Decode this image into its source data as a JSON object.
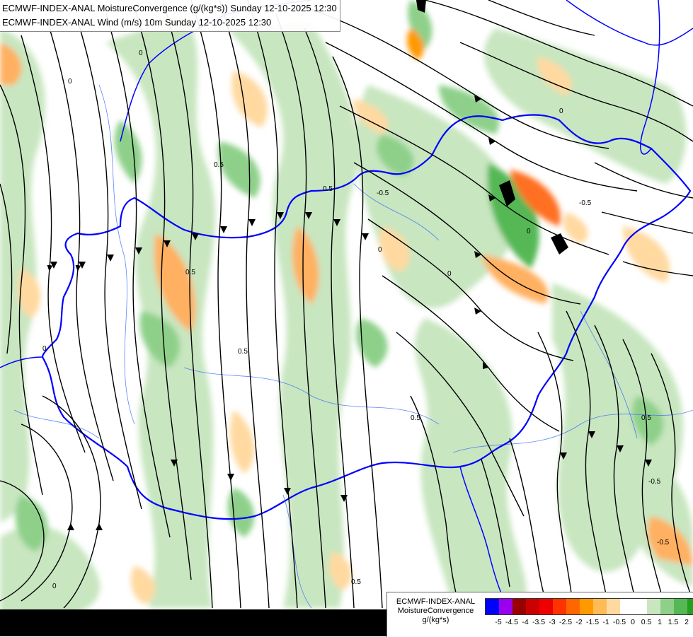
{
  "header": {
    "line1": "ECMWF-INDEX-ANAL MoistureConvergence (g/(kg*s)) Sunday 12-10-2025 12:30",
    "line2": "ECMWF-INDEX-ANAL Wind (m/s) 10m Sunday 12-10-2025 12:30"
  },
  "legend": {
    "line1": "ECMWF-INDEX-ANAL",
    "line2": "MoistureConvergence",
    "line3": "g/(kg*s)",
    "colors": [
      "#0000ff",
      "#9900ee",
      "#990000",
      "#cc0000",
      "#ee0000",
      "#ff3300",
      "#ff6600",
      "#ff9900",
      "#ffbb55",
      "#ffd9a0",
      "#ffffff",
      "#ffffff",
      "#c8e6c0",
      "#8ed08a",
      "#55b855",
      "#22a022",
      "#009900"
    ],
    "ticks": [
      "-5",
      "-4.5",
      "-4",
      "-3.5",
      "-3",
      "-2.5",
      "-2",
      "-1.5",
      "-1",
      "-0.5",
      "0",
      "0.5",
      "1",
      "1.5",
      "2"
    ]
  },
  "colors": {
    "border": "#0000ff",
    "river": "#3366ff",
    "streamline": "#000000",
    "positive_light": "#c8e6c0",
    "positive_mid": "#8ed08a",
    "positive_dark": "#3aaa3a",
    "negative_light": "#ffd9a0",
    "negative_mid": "#ffb060",
    "negative_dark": "#ff7020",
    "extreme": "#000000"
  },
  "contour_labels": [
    "0",
    "0.5",
    "-0.5",
    "0",
    "0.5",
    "0",
    "0.5",
    "0",
    "-0.5",
    "0",
    "0.5",
    "0",
    "0.5",
    "-0.5",
    "0",
    "0.5",
    "0",
    "0.5",
    "0",
    "-0.5"
  ]
}
